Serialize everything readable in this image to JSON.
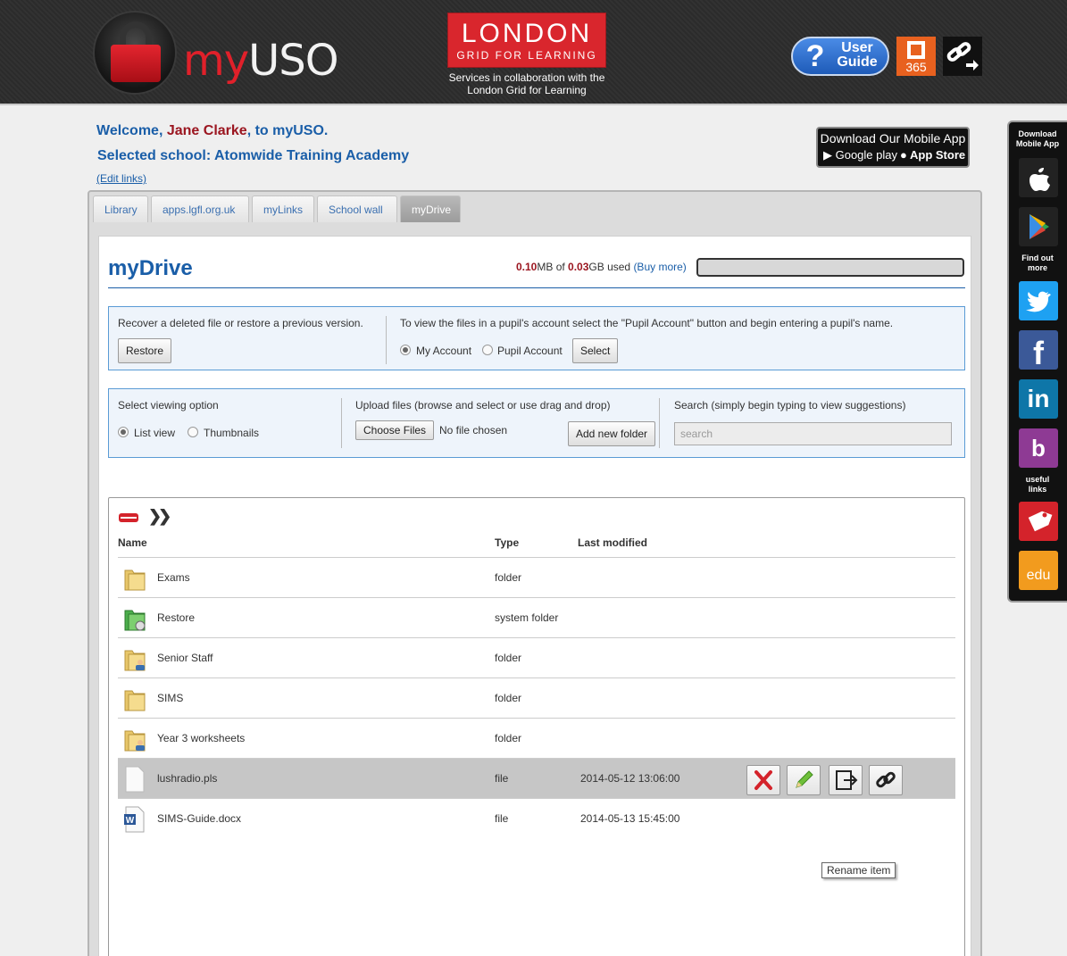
{
  "header": {
    "logo_my": "my",
    "logo_uso": "USO",
    "lgfl_title": "LONDON",
    "lgfl_subtitle": "GRID FOR LEARNING",
    "lgfl_caption_line1": "Services in collaboration with the",
    "lgfl_caption_line2": "London Grid for Learning",
    "user_guide_label_1": "User",
    "user_guide_label_2": "Guide",
    "office_label": "365"
  },
  "welcome": {
    "prefix": "Welcome, ",
    "name": "Jane Clarke",
    "suffix": ", to myUSO.",
    "school": "Selected school: Atomwide Training Academy",
    "edit_links": "(Edit links)"
  },
  "mobile_banner": {
    "title": "Download Our Mobile App",
    "google": "Google play",
    "apple": "App Store"
  },
  "sidebar": {
    "download_label_1": "Download",
    "download_label_2": "Mobile App",
    "find_out_1": "Find out",
    "find_out_2": "more",
    "useful_1": "useful",
    "useful_2": "links",
    "edu": "edu"
  },
  "tabs": [
    "Library",
    "apps.lgfl.org.uk",
    "myLinks",
    "School wall",
    "myDrive"
  ],
  "active_tab": "myDrive",
  "drive": {
    "title": "myDrive",
    "used_value": "0.10",
    "used_unit": "MB of ",
    "quota_value": "0.03",
    "quota_unit": "GB used ",
    "buy_more": "(Buy more)",
    "usage_fraction": 0
  },
  "restore_box": {
    "text": "Recover a deleted file or restore a previous version.",
    "button": "Restore",
    "pupil_text": "To view the files in a pupil's account select the \"Pupil Account\" button and begin entering a pupil's name.",
    "my_account": "My Account",
    "pupil_account": "Pupil Account",
    "select_button": "Select"
  },
  "options_box": {
    "view_label": "Select viewing option",
    "list_view": "List view",
    "thumbnails": "Thumbnails",
    "upload_label": "Upload files (browse and select or use drag and drop)",
    "choose_files": "Choose Files",
    "no_file": "No file chosen",
    "add_folder": "Add new folder",
    "search_label": "Search (simply begin typing to view suggestions)",
    "search_placeholder": "search"
  },
  "file_list": {
    "columns": {
      "name": "Name",
      "type": "Type",
      "modified": "Last modified"
    },
    "rows": [
      {
        "name": "Exams",
        "type": "folder",
        "modified": "",
        "icon": "folder-icon"
      },
      {
        "name": "Restore",
        "type": "system folder",
        "modified": "",
        "icon": "restore-folder-icon"
      },
      {
        "name": "Senior Staff",
        "type": "folder",
        "modified": "",
        "icon": "shared-folder-icon"
      },
      {
        "name": "SIMS",
        "type": "folder",
        "modified": "",
        "icon": "folder-icon"
      },
      {
        "name": "Year 3 worksheets",
        "type": "folder",
        "modified": "",
        "icon": "shared-folder-icon"
      },
      {
        "name": "lushradio.pls",
        "type": "file",
        "modified": "2014-05-12 13:06:00",
        "icon": "file-icon"
      },
      {
        "name": "SIMS-Guide.docx",
        "type": "file",
        "modified": "2014-05-13 15:45:00",
        "icon": "word-doc-icon"
      }
    ],
    "tooltip": "Rename item"
  },
  "colors": {
    "brand_red": "#e0202a",
    "link_blue": "#1a5ea8",
    "name_red": "#9b1620",
    "box_border": "#5a9bd5"
  }
}
